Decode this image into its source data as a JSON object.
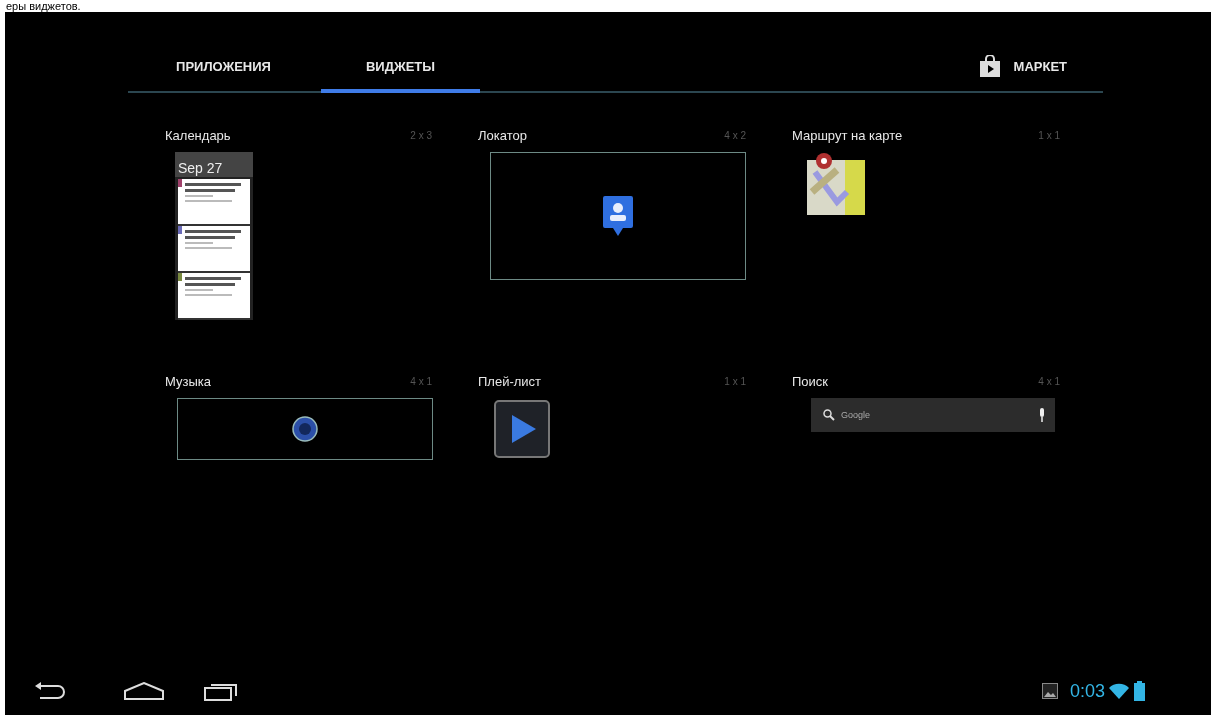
{
  "caption": "еры виджетов.",
  "tabs": [
    {
      "label": "ПРИЛОЖЕНИЯ",
      "selected": false
    },
    {
      "label": "ВИДЖЕТЫ",
      "selected": true
    }
  ],
  "store_button": {
    "label": "МАРКЕТ"
  },
  "widgets": [
    {
      "name": "Календарь",
      "size": "2 x 3",
      "kind": "calendar",
      "date": "Sep 27"
    },
    {
      "name": "Локатор",
      "size": "4 x 2",
      "kind": "locator"
    },
    {
      "name": "Маршрут на карте",
      "size": "1 x 1",
      "kind": "map"
    },
    {
      "name": "Музыка",
      "size": "4 x 1",
      "kind": "music"
    },
    {
      "name": "Плей-лист",
      "size": "1 x 1",
      "kind": "playlist"
    },
    {
      "name": "Поиск",
      "size": "4 x 1",
      "kind": "search",
      "placeholder": "Google"
    }
  ],
  "status_bar": {
    "time": "0:03"
  }
}
